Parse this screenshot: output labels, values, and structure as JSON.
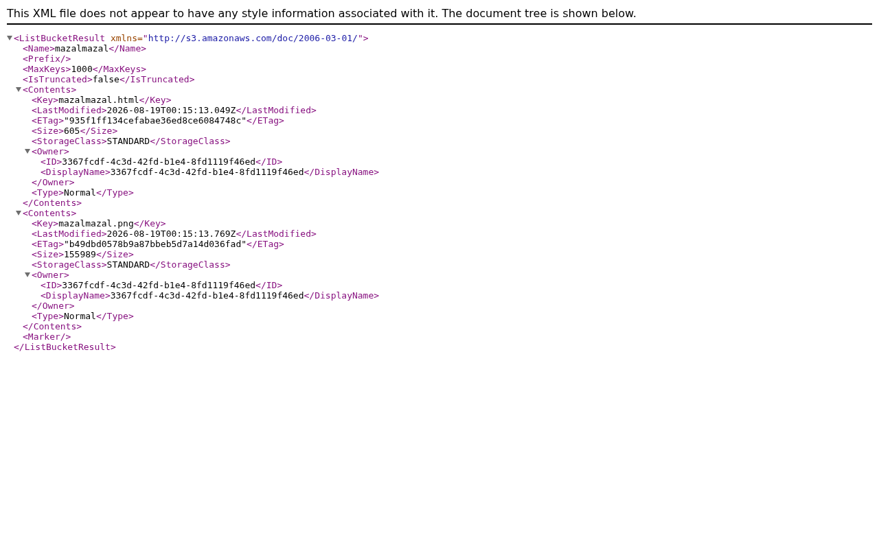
{
  "notice": "This XML file does not appear to have any style information associated with it. The document tree is shown below.",
  "tree": {
    "kind": "branch",
    "expanded": true,
    "open": [
      {
        "kind": "tag",
        "text": "<ListBucketResult"
      },
      {
        "kind": "attr_name",
        "text": "xmlns="
      },
      {
        "kind": "tag",
        "text": "\""
      },
      {
        "kind": "attr_value",
        "text": "http://s3.amazonaws.com/doc/2006-03-01/"
      },
      {
        "kind": "tag",
        "text": "\">"
      }
    ],
    "children": [
      {
        "kind": "leaf",
        "segments": [
          {
            "kind": "tag",
            "text": "<Name>"
          },
          {
            "kind": "text",
            "text": "mazalmazal"
          },
          {
            "kind": "tag",
            "text": "</Name>"
          }
        ]
      },
      {
        "kind": "leaf",
        "segments": [
          {
            "kind": "tag",
            "text": "<Prefix/>"
          }
        ]
      },
      {
        "kind": "leaf",
        "segments": [
          {
            "kind": "tag",
            "text": "<MaxKeys>"
          },
          {
            "kind": "text",
            "text": "1000"
          },
          {
            "kind": "tag",
            "text": "</MaxKeys>"
          }
        ]
      },
      {
        "kind": "leaf",
        "segments": [
          {
            "kind": "tag",
            "text": "<IsTruncated>"
          },
          {
            "kind": "text",
            "text": "false"
          },
          {
            "kind": "tag",
            "text": "</IsTruncated>"
          }
        ]
      },
      {
        "kind": "branch",
        "expanded": true,
        "open": [
          {
            "kind": "tag",
            "text": "<Contents>"
          }
        ],
        "children": [
          {
            "kind": "leaf",
            "segments": [
              {
                "kind": "tag",
                "text": "<Key>"
              },
              {
                "kind": "text",
                "text": "mazalmazal.html"
              },
              {
                "kind": "tag",
                "text": "</Key>"
              }
            ]
          },
          {
            "kind": "leaf",
            "segments": [
              {
                "kind": "tag",
                "text": "<LastModified>"
              },
              {
                "kind": "text",
                "text": "2026-08-19T00:15:13.049Z"
              },
              {
                "kind": "tag",
                "text": "</LastModified>"
              }
            ]
          },
          {
            "kind": "leaf",
            "segments": [
              {
                "kind": "tag",
                "text": "<ETag>"
              },
              {
                "kind": "text",
                "text": "\"935f1ff134cefabae36ed8ce6084748c\""
              },
              {
                "kind": "tag",
                "text": "</ETag>"
              }
            ]
          },
          {
            "kind": "leaf",
            "segments": [
              {
                "kind": "tag",
                "text": "<Size>"
              },
              {
                "kind": "text",
                "text": "605"
              },
              {
                "kind": "tag",
                "text": "</Size>"
              }
            ]
          },
          {
            "kind": "leaf",
            "segments": [
              {
                "kind": "tag",
                "text": "<StorageClass>"
              },
              {
                "kind": "text",
                "text": "STANDARD"
              },
              {
                "kind": "tag",
                "text": "</StorageClass>"
              }
            ]
          },
          {
            "kind": "branch",
            "expanded": true,
            "open": [
              {
                "kind": "tag",
                "text": "<Owner>"
              }
            ],
            "children": [
              {
                "kind": "leaf",
                "segments": [
                  {
                    "kind": "tag",
                    "text": "<ID>"
                  },
                  {
                    "kind": "text",
                    "text": "3367fcdf-4c3d-42fd-b1e4-8fd1119f46ed"
                  },
                  {
                    "kind": "tag",
                    "text": "</ID>"
                  }
                ]
              },
              {
                "kind": "leaf",
                "segments": [
                  {
                    "kind": "tag",
                    "text": "<DisplayName>"
                  },
                  {
                    "kind": "text",
                    "text": "3367fcdf-4c3d-42fd-b1e4-8fd1119f46ed"
                  },
                  {
                    "kind": "tag",
                    "text": "</DisplayName>"
                  }
                ]
              }
            ],
            "close": [
              {
                "kind": "tag",
                "text": "</Owner>"
              }
            ]
          },
          {
            "kind": "leaf",
            "segments": [
              {
                "kind": "tag",
                "text": "<Type>"
              },
              {
                "kind": "text",
                "text": "Normal"
              },
              {
                "kind": "tag",
                "text": "</Type>"
              }
            ]
          }
        ],
        "close": [
          {
            "kind": "tag",
            "text": "</Contents>"
          }
        ]
      },
      {
        "kind": "branch",
        "expanded": true,
        "open": [
          {
            "kind": "tag",
            "text": "<Contents>"
          }
        ],
        "children": [
          {
            "kind": "leaf",
            "segments": [
              {
                "kind": "tag",
                "text": "<Key>"
              },
              {
                "kind": "text",
                "text": "mazalmazal.png"
              },
              {
                "kind": "tag",
                "text": "</Key>"
              }
            ]
          },
          {
            "kind": "leaf",
            "segments": [
              {
                "kind": "tag",
                "text": "<LastModified>"
              },
              {
                "kind": "text",
                "text": "2026-08-19T00:15:13.769Z"
              },
              {
                "kind": "tag",
                "text": "</LastModified>"
              }
            ]
          },
          {
            "kind": "leaf",
            "segments": [
              {
                "kind": "tag",
                "text": "<ETag>"
              },
              {
                "kind": "text",
                "text": "\"b49dbd0578b9a87bbeb5d7a14d036fad\""
              },
              {
                "kind": "tag",
                "text": "</ETag>"
              }
            ]
          },
          {
            "kind": "leaf",
            "segments": [
              {
                "kind": "tag",
                "text": "<Size>"
              },
              {
                "kind": "text",
                "text": "155989"
              },
              {
                "kind": "tag",
                "text": "</Size>"
              }
            ]
          },
          {
            "kind": "leaf",
            "segments": [
              {
                "kind": "tag",
                "text": "<StorageClass>"
              },
              {
                "kind": "text",
                "text": "STANDARD"
              },
              {
                "kind": "tag",
                "text": "</StorageClass>"
              }
            ]
          },
          {
            "kind": "branch",
            "expanded": true,
            "open": [
              {
                "kind": "tag",
                "text": "<Owner>"
              }
            ],
            "children": [
              {
                "kind": "leaf",
                "segments": [
                  {
                    "kind": "tag",
                    "text": "<ID>"
                  },
                  {
                    "kind": "text",
                    "text": "3367fcdf-4c3d-42fd-b1e4-8fd1119f46ed"
                  },
                  {
                    "kind": "tag",
                    "text": "</ID>"
                  }
                ]
              },
              {
                "kind": "leaf",
                "segments": [
                  {
                    "kind": "tag",
                    "text": "<DisplayName>"
                  },
                  {
                    "kind": "text",
                    "text": "3367fcdf-4c3d-42fd-b1e4-8fd1119f46ed"
                  },
                  {
                    "kind": "tag",
                    "text": "</DisplayName>"
                  }
                ]
              }
            ],
            "close": [
              {
                "kind": "tag",
                "text": "</Owner>"
              }
            ]
          },
          {
            "kind": "leaf",
            "segments": [
              {
                "kind": "tag",
                "text": "<Type>"
              },
              {
                "kind": "text",
                "text": "Normal"
              },
              {
                "kind": "tag",
                "text": "</Type>"
              }
            ]
          }
        ],
        "close": [
          {
            "kind": "tag",
            "text": "</Contents>"
          }
        ]
      },
      {
        "kind": "leaf",
        "segments": [
          {
            "kind": "tag",
            "text": "<Marker/>"
          }
        ]
      }
    ],
    "close": [
      {
        "kind": "tag",
        "text": "</ListBucketResult>"
      }
    ]
  }
}
